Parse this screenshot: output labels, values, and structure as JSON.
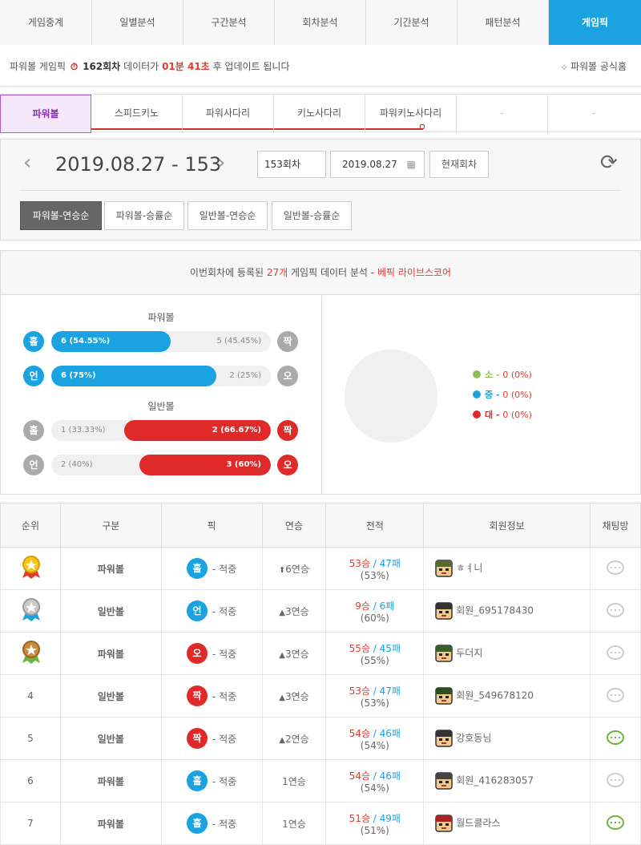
{
  "tabs": [
    {
      "label": "게임중계",
      "w": 115
    },
    {
      "label": "일별분석",
      "w": 114
    },
    {
      "label": "구간분석",
      "w": 114
    },
    {
      "label": "회차분석",
      "w": 114
    },
    {
      "label": "기간분석",
      "w": 114
    },
    {
      "label": "패턴분석",
      "w": 114
    },
    {
      "label": "게임픽",
      "w": 115,
      "active": true
    }
  ],
  "notice": {
    "prefix": "파워볼 게임픽",
    "round": "162회차",
    "mid": "데이터가",
    "time": "01분 41초",
    "suffix": "후 업데이트 됩니다",
    "official": "파워볼 공식홈"
  },
  "game_tabs": [
    "파워볼",
    "스피드키노",
    "파워사다리",
    "키노사다리",
    "파워키노사다리",
    "-",
    "-"
  ],
  "date": {
    "title": "2019.08.27 - 153",
    "round_input": "153회차",
    "date_input": "2019.08.27",
    "current_btn": "현재회차"
  },
  "sort_tabs": [
    "파워볼-연승순",
    "파워볼-승률순",
    "일반볼-연승순",
    "일반볼-승률순"
  ],
  "analysis": {
    "pre": "이번회차에 등록된",
    "count": "27개",
    "mid": "게임픽 데이터 분석 -",
    "brand": "베픽 라이브스코어",
    "powerball_label": "파워볼",
    "normal_label": "일반볼",
    "rows": [
      {
        "left_icon": "홀",
        "right_icon": "짝",
        "left": "6 (54.55%)",
        "right": "5 (45.45%)",
        "left_share": 0.5455,
        "win": "left",
        "color": "#1aa3e0"
      },
      {
        "left_icon": "언",
        "right_icon": "오",
        "left": "6 (75%)",
        "right": "2 (25%)",
        "left_share": 0.75,
        "win": "left",
        "color": "#1aa3e0"
      },
      {
        "left_icon": "홀",
        "right_icon": "짝",
        "left": "1 (33.33%)",
        "right": "2 (66.67%)",
        "left_share": 0.3333,
        "win": "right",
        "color": "#e02a2a"
      },
      {
        "left_icon": "언",
        "right_icon": "오",
        "left": "2 (40%)",
        "right": "3 (60%)",
        "left_share": 0.4,
        "win": "right",
        "color": "#e02a2a"
      }
    ],
    "legend": [
      {
        "label": "소",
        "value": "0 (0%)",
        "color": "#8cc152"
      },
      {
        "label": "중",
        "value": "0 (0%)",
        "color": "#1aa3e0"
      },
      {
        "label": "대",
        "value": "0 (0%)",
        "color": "#e02a2a"
      }
    ]
  },
  "table": {
    "headers": [
      "순위",
      "구분",
      "픽",
      "연승",
      "전적",
      "회원정보",
      "채팅방"
    ],
    "rows": [
      {
        "rank": "1",
        "medal": "gold",
        "type": "파워볼",
        "pick": "홀",
        "pick_color": "#1aa3e0",
        "pick_text": "적중",
        "streak": "6연승",
        "streak_icon": "⬆",
        "win": "53승",
        "loss": "47패",
        "pct": "(53%)",
        "member": "ㅎㅕ니",
        "chat_on": false
      },
      {
        "rank": "2",
        "medal": "silver",
        "type": "일반볼",
        "pick": "언",
        "pick_color": "#1aa3e0",
        "pick_text": "적중",
        "streak": "3연승",
        "streak_icon": "▲",
        "win": "9승",
        "loss": "6패",
        "pct": "(60%)",
        "member": "회원_695178430",
        "chat_on": false
      },
      {
        "rank": "3",
        "medal": "bronze",
        "type": "파워볼",
        "pick": "오",
        "pick_color": "#e02a2a",
        "pick_text": "적중",
        "streak": "3연승",
        "streak_icon": "▲",
        "win": "55승",
        "loss": "45패",
        "pct": "(55%)",
        "member": "두더지",
        "chat_on": false
      },
      {
        "rank": "4",
        "medal": "",
        "type": "일반볼",
        "pick": "짝",
        "pick_color": "#e02a2a",
        "pick_text": "적중",
        "streak": "3연승",
        "streak_icon": "▲",
        "win": "53승",
        "loss": "47패",
        "pct": "(53%)",
        "member": "회원_549678120",
        "chat_on": false
      },
      {
        "rank": "5",
        "medal": "",
        "type": "일반볼",
        "pick": "짝",
        "pick_color": "#e02a2a",
        "pick_text": "적중",
        "streak": "2연승",
        "streak_icon": "▲",
        "win": "54승",
        "loss": "46패",
        "pct": "(54%)",
        "member": "강호동님",
        "chat_on": true
      },
      {
        "rank": "6",
        "medal": "",
        "type": "파워볼",
        "pick": "홀",
        "pick_color": "#1aa3e0",
        "pick_text": "적중",
        "streak": "1연승",
        "streak_icon": "",
        "win": "54승",
        "loss": "46패",
        "pct": "(54%)",
        "member": "회원_416283057",
        "chat_on": false
      },
      {
        "rank": "7",
        "medal": "",
        "type": "파워볼",
        "pick": "홀",
        "pick_color": "#1aa3e0",
        "pick_text": "적중",
        "streak": "1연승",
        "streak_icon": "",
        "win": "51승",
        "loss": "49패",
        "pct": "(51%)",
        "member": "월드클라스",
        "chat_on": true
      }
    ]
  }
}
